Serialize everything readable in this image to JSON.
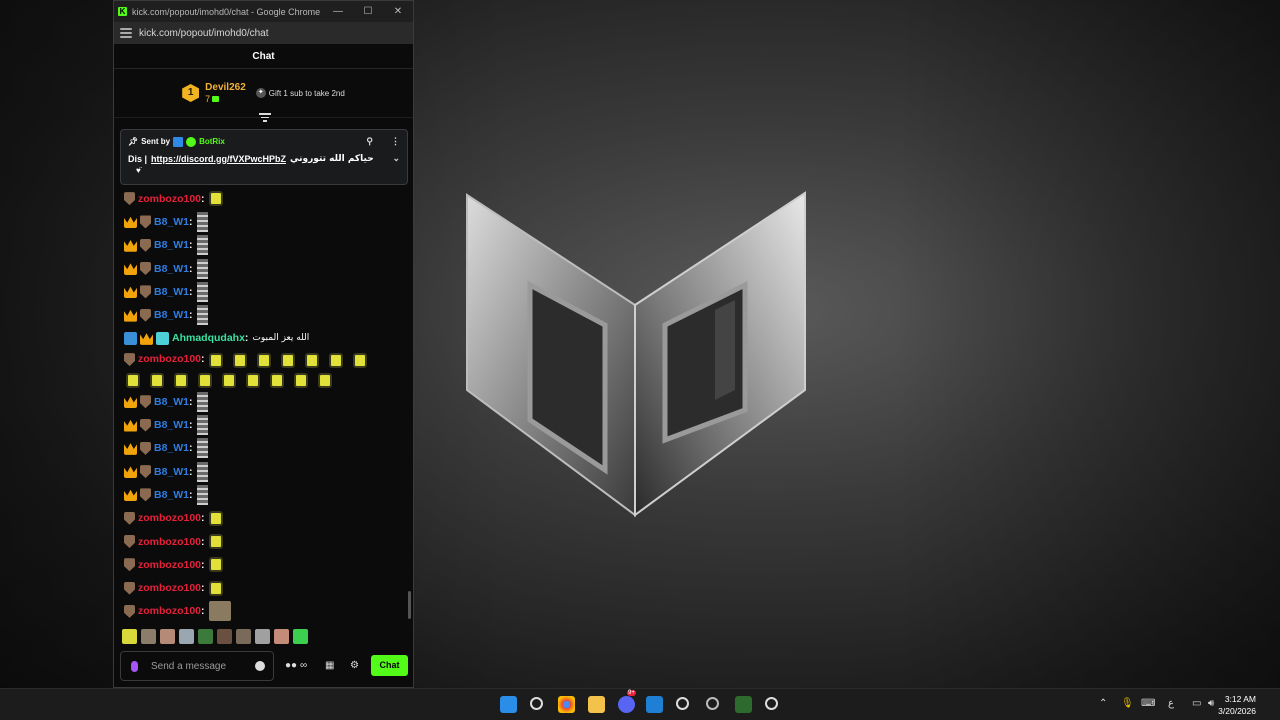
{
  "window": {
    "title": "kick.com/popout/imohd0/chat - Google Chrome",
    "url": "kick.com/popout/imohd0/chat",
    "minimize": "—",
    "maximize": "☐",
    "close": "✕"
  },
  "chat": {
    "header": "Chat",
    "leaderboard": {
      "rank": "1",
      "username": "Devil262",
      "count": "7",
      "gift_text": "Gift 1 sub to take 2nd"
    },
    "pinned": {
      "sent_by_label": "Sent by",
      "sender": "BotRix",
      "message_prefix": "Dis |",
      "link": "https://discord.gg/fVXPwcHPbZ",
      "arabic_text": "حياكم الله تتوروني",
      "heart": "♥̈"
    },
    "messages": [
      {
        "user": "zombozo100",
        "color": "red",
        "badges": [
          "shield"
        ],
        "emotes": "y1"
      },
      {
        "user": "B8_W1",
        "color": "blue",
        "badges": [
          "crown",
          "shield"
        ],
        "emotes": "g"
      },
      {
        "user": "B8_W1",
        "color": "blue",
        "badges": [
          "crown",
          "shield"
        ],
        "emotes": "g"
      },
      {
        "user": "B8_W1",
        "color": "blue",
        "badges": [
          "crown",
          "shield"
        ],
        "emotes": "g"
      },
      {
        "user": "B8_W1",
        "color": "blue",
        "badges": [
          "crown",
          "shield"
        ],
        "emotes": "g"
      },
      {
        "user": "B8_W1",
        "color": "blue",
        "badges": [
          "crown",
          "shield"
        ],
        "emotes": "g"
      },
      {
        "user": "Ahmadqudahx",
        "color": "teal",
        "badges": [
          "mod",
          "crown",
          "sub"
        ],
        "text": "الله يعز المبوت"
      },
      {
        "user": "zombozo100",
        "color": "red",
        "badges": [
          "shield"
        ],
        "emotes": "y16"
      },
      {
        "user": "B8_W1",
        "color": "blue",
        "badges": [
          "crown",
          "shield"
        ],
        "emotes": "g"
      },
      {
        "user": "B8_W1",
        "color": "blue",
        "badges": [
          "crown",
          "shield"
        ],
        "emotes": "g"
      },
      {
        "user": "B8_W1",
        "color": "blue",
        "badges": [
          "crown",
          "shield"
        ],
        "emotes": "g"
      },
      {
        "user": "B8_W1",
        "color": "blue",
        "badges": [
          "crown",
          "shield"
        ],
        "emotes": "g"
      },
      {
        "user": "B8_W1",
        "color": "blue",
        "badges": [
          "crown",
          "shield"
        ],
        "emotes": "g"
      },
      {
        "user": "zombozo100",
        "color": "red",
        "badges": [
          "shield"
        ],
        "emotes": "y1"
      },
      {
        "user": "zombozo100",
        "color": "red",
        "badges": [
          "shield"
        ],
        "emotes": "y1"
      },
      {
        "user": "zombozo100",
        "color": "red",
        "badges": [
          "shield"
        ],
        "emotes": "y1"
      },
      {
        "user": "zombozo100",
        "color": "red",
        "badges": [
          "shield"
        ],
        "emotes": "y1"
      },
      {
        "user": "zombozo100",
        "color": "red",
        "badges": [
          "shield"
        ],
        "emotes": "pic"
      }
    ],
    "colon": ":",
    "input_placeholder": "Send a message",
    "send_label": "Chat"
  },
  "taskbar": {
    "time": "3:12 AM",
    "date": "3/20/2026",
    "language": "ع",
    "discord_badge": "9+"
  },
  "colors": {
    "kick_green": "#53fc18",
    "name_red": "#e8213a",
    "name_blue": "#2f7de1",
    "name_teal": "#38e2a0",
    "leader_gold": "#f2b237"
  }
}
